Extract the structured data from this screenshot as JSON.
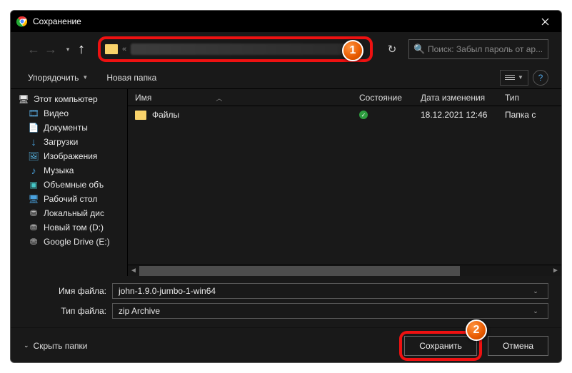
{
  "title": "Сохранение",
  "nav": {
    "addr_sep": "«"
  },
  "search": {
    "placeholder": "Поиск: Забыл пароль от ар..."
  },
  "toolbar": {
    "organize": "Упорядочить",
    "new_folder": "Новая папка"
  },
  "tree": {
    "root": "Этот компьютер",
    "items": [
      {
        "label": "Видео",
        "icon": "🎞"
      },
      {
        "label": "Документы",
        "icon": "📄"
      },
      {
        "label": "Загрузки",
        "icon": "↓"
      },
      {
        "label": "Изображения",
        "icon": "🖼"
      },
      {
        "label": "Музыка",
        "icon": "♪"
      },
      {
        "label": "Объемные объ",
        "icon": "▣"
      },
      {
        "label": "Рабочий стол",
        "icon": "🖥"
      },
      {
        "label": "Локальный дис",
        "icon": "⛃"
      },
      {
        "label": "Новый том (D:)",
        "icon": "⛃"
      },
      {
        "label": "Google Drive (E:)",
        "icon": "⛃"
      }
    ]
  },
  "columns": {
    "name": "Имя",
    "status": "Состояние",
    "date": "Дата изменения",
    "type": "Тип"
  },
  "rows": [
    {
      "name": "Файлы",
      "date": "18.12.2021 12:46",
      "type": "Папка с"
    }
  ],
  "fields": {
    "filename_label": "Имя файла:",
    "filename_value": "john-1.9.0-jumbo-1-win64",
    "filetype_label": "Тип файла:",
    "filetype_value": "zip Archive"
  },
  "footer": {
    "hide_folders": "Скрыть папки",
    "save": "Сохранить",
    "cancel": "Отмена"
  },
  "markers": {
    "m1": "1",
    "m2": "2"
  }
}
